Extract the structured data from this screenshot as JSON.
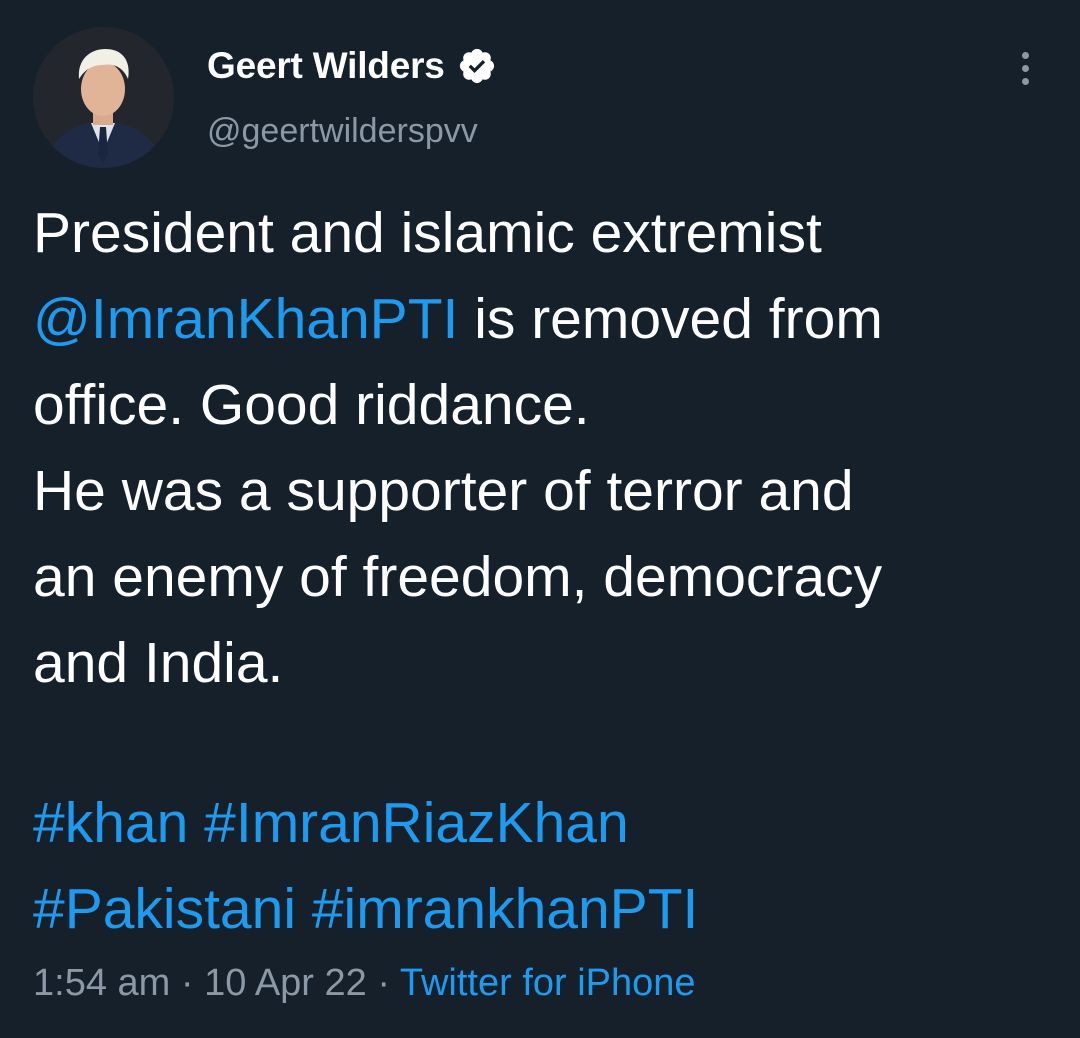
{
  "author": {
    "name": "Geert Wilders",
    "handle": "@geertwilderspvv",
    "verified_icon": "verified-badge-icon",
    "avatar": "profile-photo"
  },
  "tweet": {
    "line1": "President and islamic extremist",
    "mention": "@ImranKhanPTI",
    "line2_rest": " is removed from",
    "line3": "office. Good riddance.",
    "line4": "He was a supporter of terror and",
    "line5": "an enemy of freedom, democracy",
    "line6": "and India.",
    "hashtags_line1": [
      "#khan",
      "#ImranRiazKhan"
    ],
    "hashtags_line2": [
      "#Pakistani",
      "#imrankhanPTI"
    ]
  },
  "meta": {
    "time": "1:54 am",
    "separator": " · ",
    "date": "10 Apr 22",
    "source": "Twitter for iPhone"
  },
  "colors": {
    "background": "#15202b",
    "link": "#1d9bf0",
    "secondary_text": "#8b98a5",
    "primary_text": "#ffffff"
  },
  "icons": {
    "more": "more-options-icon"
  }
}
